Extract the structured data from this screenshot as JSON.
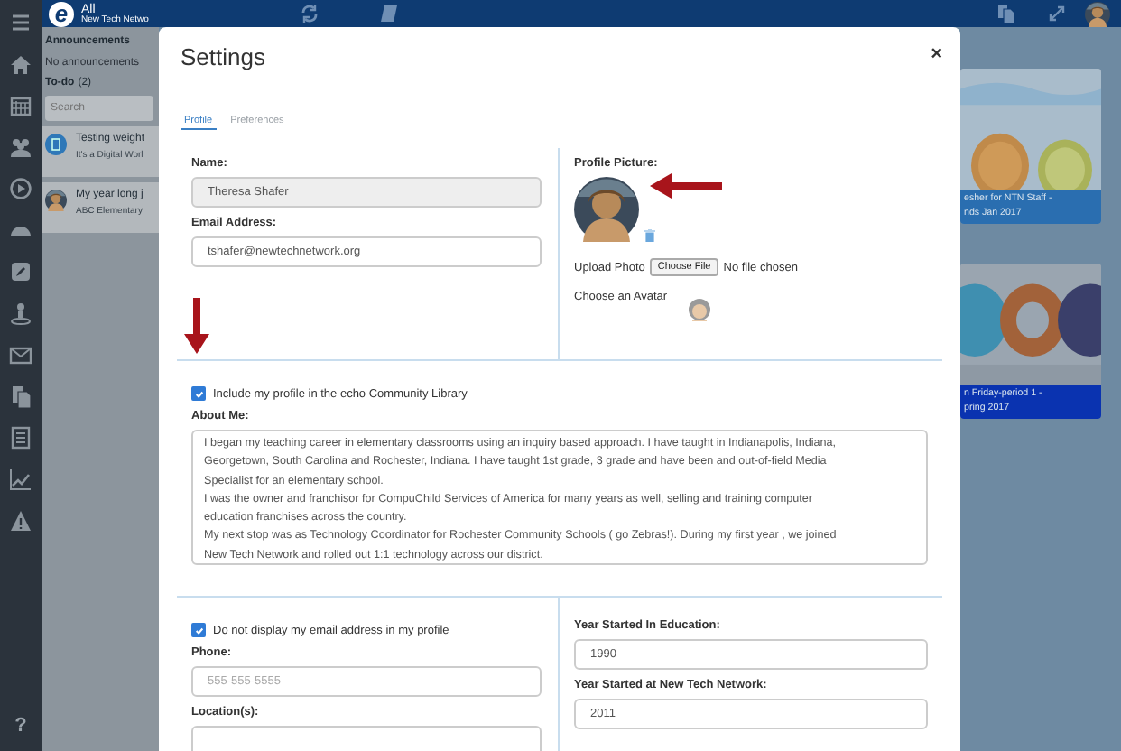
{
  "top_bar": {
    "logo_text": "e",
    "scope_title": "All",
    "scope_subtitle": "New Tech Netwo"
  },
  "sidebar": {
    "help": "?"
  },
  "announcements": {
    "title": "Announcements",
    "empty_text": "No announcements"
  },
  "todo": {
    "title": "To-do",
    "count": "(2)",
    "search_placeholder": "Search",
    "items": [
      {
        "kind": "document",
        "title": "Testing weight",
        "subtitle": "It's a Digital Worl"
      },
      {
        "kind": "person",
        "title": "My year long j",
        "subtitle": "ABC Elementary"
      }
    ]
  },
  "cards": [
    {
      "caption": "esher for NTN Staff -\nnds Jan 2017"
    },
    {
      "caption": "n Friday-period 1 -\npring 2017"
    }
  ],
  "settings": {
    "title": "Settings",
    "close": "×",
    "tabs": [
      {
        "label": "Profile",
        "selected": true
      },
      {
        "label": "Preferences",
        "selected": false
      }
    ],
    "name": {
      "label": "Name:",
      "value": "Theresa Shafer",
      "disabled": true
    },
    "email": {
      "label": "Email Address:",
      "value": "tshafer@newtechnetwork.org"
    },
    "profile_picture": {
      "label": "Profile Picture:"
    },
    "upload": {
      "label": "Upload Photo",
      "button": "Choose File",
      "status": "No file chosen"
    },
    "avatar_choice": {
      "label": "Choose an Avatar"
    },
    "include_in_library": {
      "label": "Include my profile in the echo Community Library",
      "checked": true
    },
    "about_me": {
      "label": "About Me:",
      "value": "I began my teaching career in elementary classrooms using an inquiry based approach. I have taught in Indianapolis, Indiana,\nGeorgetown, South Carolina and Rochester, Indiana.  I have taught 1st grade, 3 grade and have been and out-of-field Media\nSpecialist for an elementary school.\nI was the owner and franchisor for CompuChild Services of America for many years as well, selling and training computer\neducation franchises across the country.\nMy next stop was as Technology Coordinator for Rochester Community Schools ( go Zebras!). During my first year , we joined\nNew Tech Network and rolled out 1:1 technology across our district."
    },
    "hide_email": {
      "label": "Do not display my email address in my profile",
      "checked": true
    },
    "phone": {
      "label": "Phone:",
      "placeholder": "555-555-5555"
    },
    "location": {
      "label": "Location(s):"
    },
    "year_education": {
      "label": "Year Started In Education:",
      "value": "1990"
    },
    "year_ntn": {
      "label": "Year Started at New Tech Network:",
      "value": "2011"
    }
  }
}
